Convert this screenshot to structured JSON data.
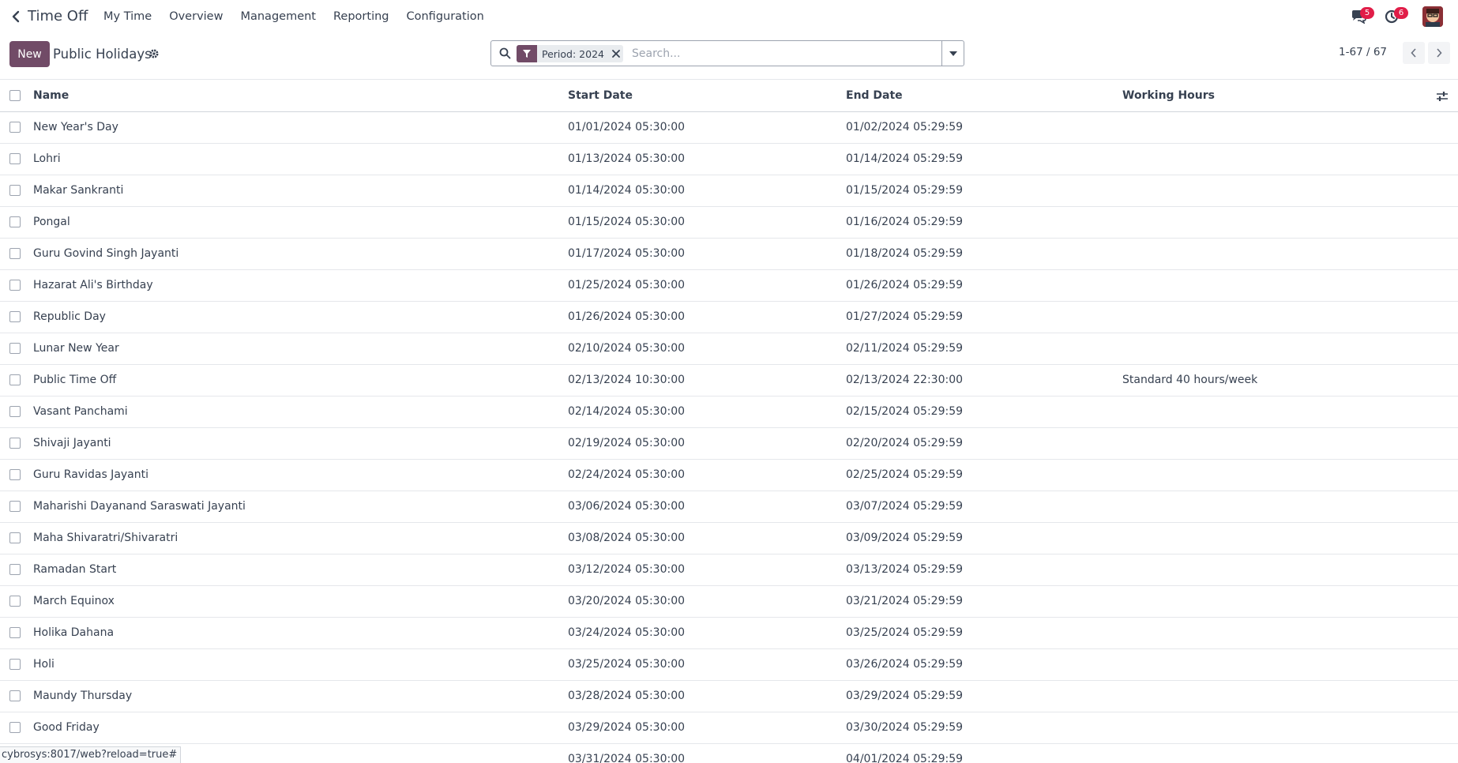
{
  "navbar": {
    "app_title": "Time Off",
    "menu": [
      "My Time",
      "Overview",
      "Management",
      "Reporting",
      "Configuration"
    ],
    "messages_count": "5",
    "activities_count": "6"
  },
  "control": {
    "new_label": "New",
    "title": "Public Holidays",
    "facet_label": "Period: 2024",
    "search_placeholder": "Search...",
    "pager": "1-67 / 67"
  },
  "table": {
    "headers": [
      "Name",
      "Start Date",
      "End Date",
      "Working Hours"
    ],
    "rows": [
      {
        "name": "New Year's Day",
        "start": "01/01/2024 05:30:00",
        "end": "01/02/2024 05:29:59",
        "hours": ""
      },
      {
        "name": "Lohri",
        "start": "01/13/2024 05:30:00",
        "end": "01/14/2024 05:29:59",
        "hours": ""
      },
      {
        "name": "Makar Sankranti",
        "start": "01/14/2024 05:30:00",
        "end": "01/15/2024 05:29:59",
        "hours": ""
      },
      {
        "name": "Pongal",
        "start": "01/15/2024 05:30:00",
        "end": "01/16/2024 05:29:59",
        "hours": ""
      },
      {
        "name": "Guru Govind Singh Jayanti",
        "start": "01/17/2024 05:30:00",
        "end": "01/18/2024 05:29:59",
        "hours": ""
      },
      {
        "name": "Hazarat Ali's Birthday",
        "start": "01/25/2024 05:30:00",
        "end": "01/26/2024 05:29:59",
        "hours": ""
      },
      {
        "name": "Republic Day",
        "start": "01/26/2024 05:30:00",
        "end": "01/27/2024 05:29:59",
        "hours": ""
      },
      {
        "name": "Lunar New Year",
        "start": "02/10/2024 05:30:00",
        "end": "02/11/2024 05:29:59",
        "hours": ""
      },
      {
        "name": "Public Time Off",
        "start": "02/13/2024 10:30:00",
        "end": "02/13/2024 22:30:00",
        "hours": "Standard 40 hours/week"
      },
      {
        "name": "Vasant Panchami",
        "start": "02/14/2024 05:30:00",
        "end": "02/15/2024 05:29:59",
        "hours": ""
      },
      {
        "name": "Shivaji Jayanti",
        "start": "02/19/2024 05:30:00",
        "end": "02/20/2024 05:29:59",
        "hours": ""
      },
      {
        "name": "Guru Ravidas Jayanti",
        "start": "02/24/2024 05:30:00",
        "end": "02/25/2024 05:29:59",
        "hours": ""
      },
      {
        "name": "Maharishi Dayanand Saraswati Jayanti",
        "start": "03/06/2024 05:30:00",
        "end": "03/07/2024 05:29:59",
        "hours": ""
      },
      {
        "name": "Maha Shivaratri/Shivaratri",
        "start": "03/08/2024 05:30:00",
        "end": "03/09/2024 05:29:59",
        "hours": ""
      },
      {
        "name": "Ramadan Start",
        "start": "03/12/2024 05:30:00",
        "end": "03/13/2024 05:29:59",
        "hours": ""
      },
      {
        "name": "March Equinox",
        "start": "03/20/2024 05:30:00",
        "end": "03/21/2024 05:29:59",
        "hours": ""
      },
      {
        "name": "Holika Dahana",
        "start": "03/24/2024 05:30:00",
        "end": "03/25/2024 05:29:59",
        "hours": ""
      },
      {
        "name": "Holi",
        "start": "03/25/2024 05:30:00",
        "end": "03/26/2024 05:29:59",
        "hours": ""
      },
      {
        "name": "Maundy Thursday",
        "start": "03/28/2024 05:30:00",
        "end": "03/29/2024 05:29:59",
        "hours": ""
      },
      {
        "name": "Good Friday",
        "start": "03/29/2024 05:30:00",
        "end": "03/30/2024 05:29:59",
        "hours": ""
      },
      {
        "name": "",
        "start": "03/31/2024 05:30:00",
        "end": "04/01/2024 05:29:59",
        "hours": ""
      }
    ]
  },
  "statusbar": {
    "url": "cybrosys:8017/web?reload=true#"
  },
  "colors": {
    "brand": "#714b67",
    "badge": "#e11d48"
  }
}
